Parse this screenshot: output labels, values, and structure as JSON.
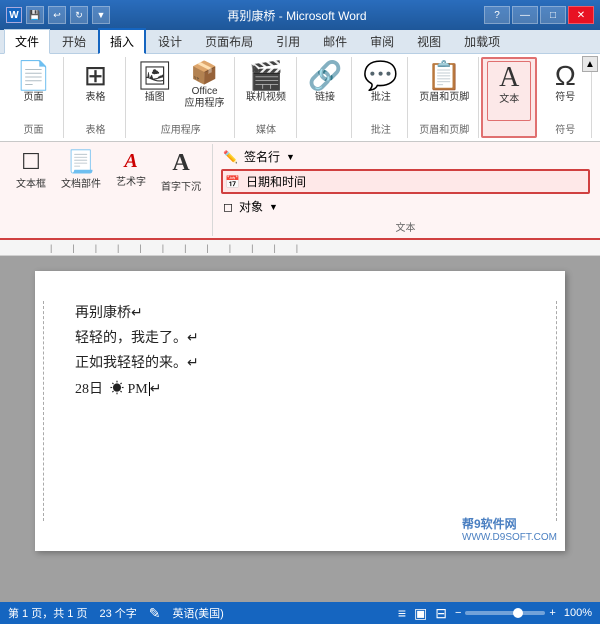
{
  "titlebar": {
    "title": "再别康桥 - Microsoft Word",
    "help_icon": "?",
    "minimize": "—",
    "restore": "□",
    "close": "✕"
  },
  "quickaccess": {
    "save": "💾",
    "undo": "↩",
    "redo": "↻"
  },
  "tabs": [
    {
      "label": "文件",
      "active": false
    },
    {
      "label": "开始",
      "active": false
    },
    {
      "label": "插入",
      "active": true
    },
    {
      "label": "设计",
      "active": false
    },
    {
      "label": "页面布局",
      "active": false
    },
    {
      "label": "引用",
      "active": false
    },
    {
      "label": "邮件",
      "active": false
    },
    {
      "label": "审阅",
      "active": false
    },
    {
      "label": "视图",
      "active": false
    },
    {
      "label": "加载项",
      "active": false
    }
  ],
  "ribbon": {
    "groups": [
      {
        "name": "pages",
        "label": "页面",
        "buttons": [
          {
            "icon": "📄",
            "label": "页面"
          }
        ]
      },
      {
        "name": "tables",
        "label": "表格",
        "buttons": [
          {
            "icon": "⊞",
            "label": "表格"
          }
        ]
      },
      {
        "name": "illustrations",
        "label": "应用程序",
        "buttons": [
          {
            "icon": "🖼",
            "label": "插图"
          },
          {
            "icon": "📦",
            "label": "Office\n应用程序"
          }
        ]
      },
      {
        "name": "media",
        "label": "媒体",
        "buttons": [
          {
            "icon": "🎬",
            "label": "联机视频"
          }
        ]
      },
      {
        "name": "links",
        "label": "",
        "buttons": [
          {
            "icon": "🔗",
            "label": "链接"
          }
        ]
      },
      {
        "name": "comments",
        "label": "批注",
        "buttons": [
          {
            "icon": "💬",
            "label": "批注"
          }
        ]
      },
      {
        "name": "header_footer",
        "label": "页眉和页脚",
        "buttons": [
          {
            "icon": "📋",
            "label": "页眉和页脚"
          }
        ]
      },
      {
        "name": "text",
        "label": "文本",
        "highlighted": true,
        "buttons": [
          {
            "icon": "A",
            "label": "文本"
          }
        ]
      },
      {
        "name": "symbols",
        "label": "符号",
        "buttons": [
          {
            "icon": "Ω",
            "label": "符号"
          }
        ]
      }
    ]
  },
  "subribbon": {
    "groups": [
      {
        "buttons": [
          {
            "icon": "☐",
            "label": "文本框"
          },
          {
            "icon": "📃",
            "label": "文档部件"
          },
          {
            "icon": "A",
            "label": "艺术字",
            "style": "italic red"
          },
          {
            "icon": "A",
            "label": "首字下沉",
            "style": "large"
          }
        ]
      },
      {
        "right_items": [
          {
            "label": "签名行",
            "icon": "✏️",
            "highlighted": false
          },
          {
            "label": "日期和时间",
            "icon": "📅",
            "highlighted": true
          },
          {
            "label": "对象",
            "icon": "◻"
          }
        ],
        "label": "文本"
      }
    ]
  },
  "document": {
    "lines": [
      "再别康桥↵",
      "轻轻的，我走了。↵",
      "正如我轻轻的来。↵",
      "28日  PM↵"
    ]
  },
  "statusbar": {
    "page_info": "第 1 页，共 1 页",
    "word_count": "23 个字",
    "lang": "英语(美国)",
    "zoom": "100%"
  },
  "watermark": {
    "site_name": "帮9软件网",
    "url": "WWW.D9SOFT.COM"
  }
}
